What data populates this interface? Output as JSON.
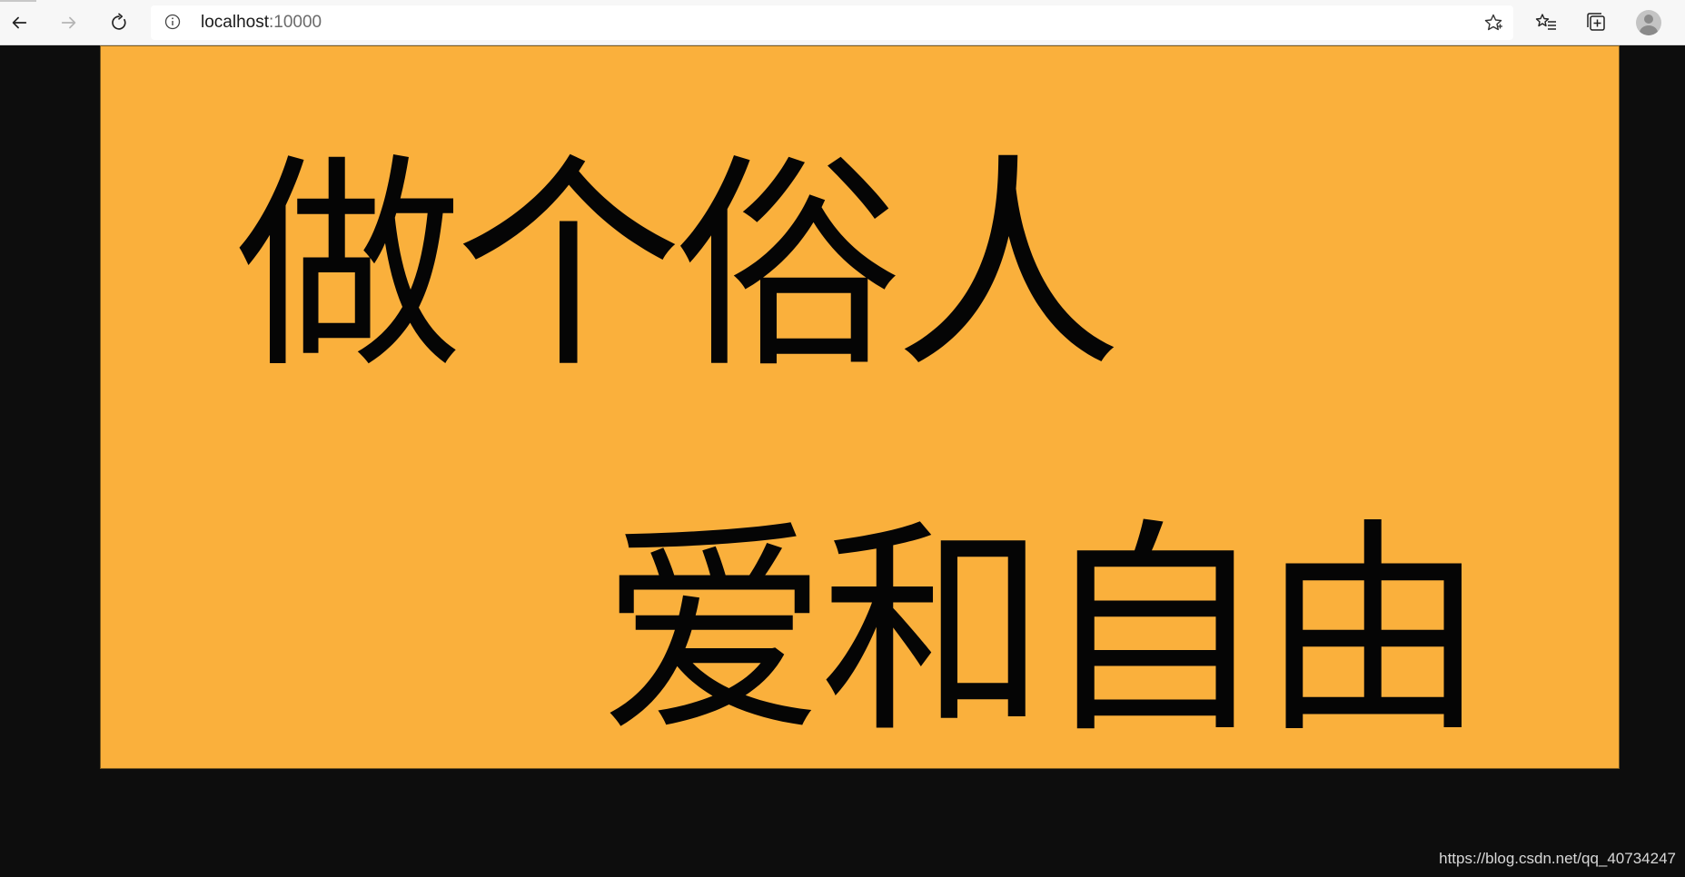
{
  "browser": {
    "address": {
      "host": "localhost",
      "port": ":10000"
    },
    "icons": {
      "back": "back-arrow-icon",
      "forward": "forward-arrow-icon",
      "refresh": "refresh-icon",
      "info": "info-icon",
      "favorite": "star-icon",
      "favorites_list": "favorites-list-icon",
      "collections": "collections-icon",
      "profile": "profile-avatar-icon"
    }
  },
  "page": {
    "background_color": "#0d0d0d",
    "panel_color": "#fab03c",
    "text_color": "#050505",
    "line1": "做个俗人",
    "line2": "爱和自由"
  },
  "watermark": "https://blog.csdn.net/qq_40734247"
}
